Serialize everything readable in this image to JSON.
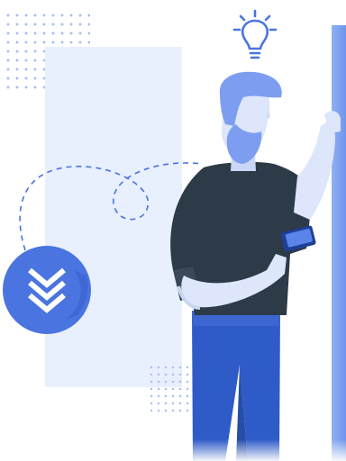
{
  "colors": {
    "accent": "#4a74e0",
    "accent_dark": "#2f5bc8",
    "panel": "#e8f0fd",
    "shirt": "#2d3a48",
    "skin": "#dde6fb",
    "hair": "#7d9ef0",
    "dots": "#a9bff0"
  },
  "icons": {
    "bulb": "lightbulb-icon",
    "badge": "chevrons-down-icon",
    "phone": "smartphone-icon"
  }
}
